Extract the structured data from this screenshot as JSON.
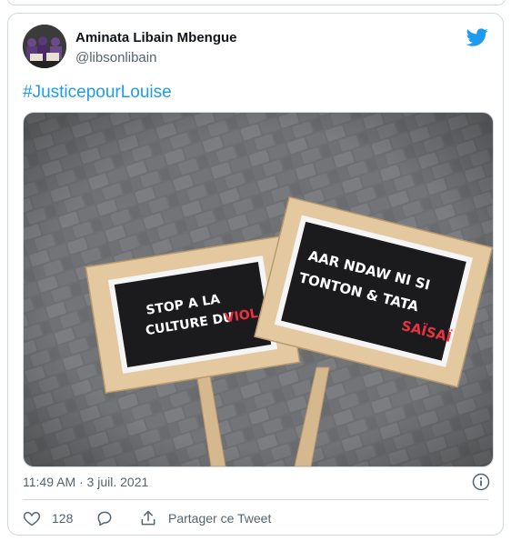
{
  "author": {
    "name": "Aminata Libain Mbengue",
    "handle": "@libsonlibain"
  },
  "tweet": {
    "text": "#JusticepourLouise",
    "timestamp": "11:49 AM · 3 juil. 2021"
  },
  "media": {
    "sign_left_line1": "STOP A LA",
    "sign_left_line2": "CULTURE DU",
    "sign_left_highlight": "VIOL",
    "sign_right_line1": "AAR NDAW NI SI",
    "sign_right_line2": "TONTON & TATA",
    "sign_right_highlight": "SAÏSAÏ"
  },
  "actions": {
    "like_count": "128",
    "share_label": "Partager ce Tweet"
  },
  "colors": {
    "accent": "#1d9bf0",
    "text_secondary": "#536471",
    "sign_highlight": "#e8333f"
  },
  "icons": {
    "logo": "twitter-bird-icon",
    "info": "info-icon",
    "like": "heart-icon",
    "reply": "speech-bubble-icon",
    "share": "share-upload-icon"
  }
}
